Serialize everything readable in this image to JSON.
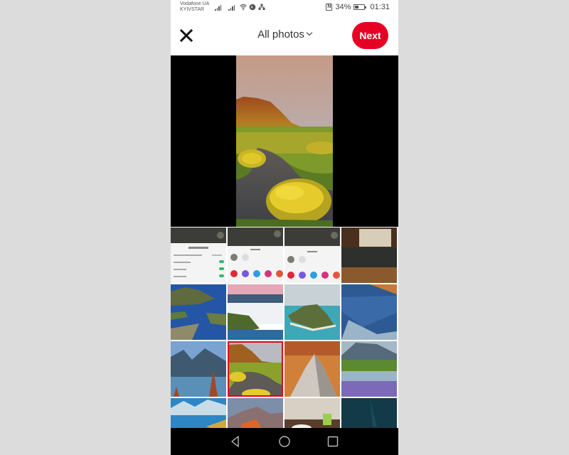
{
  "status_bar": {
    "carrier_1": "Vodafone UA",
    "carrier_2": "KYIVSTAR",
    "battery_percent": "34%",
    "battery_level": 0.34,
    "time": "01:31",
    "nfc_label": "N",
    "icons": [
      "signal-icon",
      "signal-icon",
      "wifi-icon",
      "sync-icon",
      "vpn-icon",
      "nfc-icon",
      "battery-icon"
    ]
  },
  "header": {
    "close_icon": "close-icon",
    "album_label": "All photos",
    "next_label": "Next",
    "accent_color": "#e60023"
  },
  "preview": {
    "description": "Selected photo preview: meadow with stream and yellow flowers under a hill"
  },
  "grid": {
    "columns": 4,
    "tiles": [
      {
        "desc": "screenshot - privacy settings sheet",
        "selected": false
      },
      {
        "desc": "screenshot - share sheet",
        "selected": false
      },
      {
        "desc": "screenshot - share sheet",
        "selected": false
      },
      {
        "desc": "photo - bedroom with sofa",
        "selected": false
      },
      {
        "desc": "photo - fjord islands",
        "selected": false
      },
      {
        "desc": "photo - waterfall",
        "selected": false
      },
      {
        "desc": "photo - tropical island",
        "selected": false
      },
      {
        "desc": "photo - lake reflection",
        "selected": false
      },
      {
        "desc": "photo - mountain lake",
        "selected": false
      },
      {
        "desc": "photo - meadow stream with yellow flowers",
        "selected": true
      },
      {
        "desc": "photo - snowy peak at sunset",
        "selected": false
      },
      {
        "desc": "photo - lupine field",
        "selected": false
      },
      {
        "desc": "photo - blue mountains",
        "selected": false
      },
      {
        "desc": "photo - mountain range",
        "selected": false
      },
      {
        "desc": "photo - kitchen",
        "selected": false
      },
      {
        "desc": "photo - aurora night sky",
        "selected": false
      }
    ]
  },
  "navbar": {
    "back": "back-icon",
    "home": "home-icon",
    "recents": "recents-icon"
  }
}
